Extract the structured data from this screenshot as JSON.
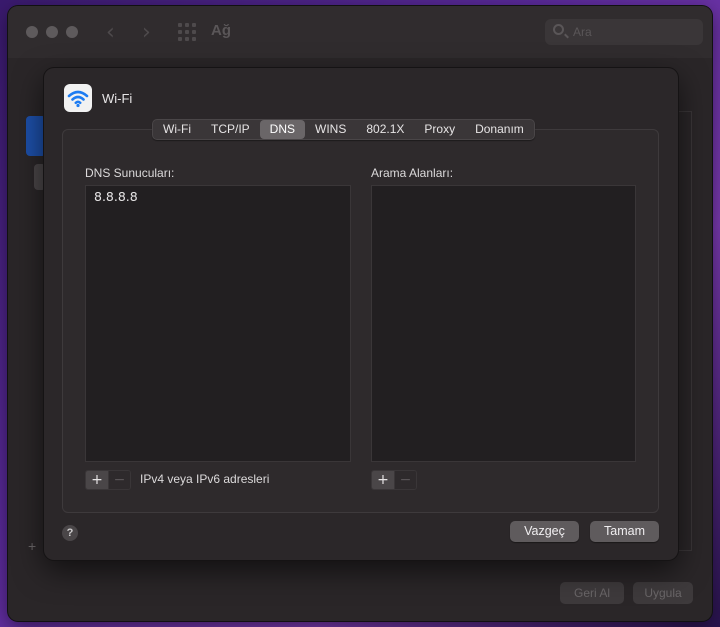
{
  "background_window": {
    "title": "Ağ",
    "search_placeholder": "Ara",
    "revert_label": "Geri Al",
    "apply_label": "Uygula"
  },
  "sheet": {
    "title": "Wi-Fi",
    "tabs": [
      {
        "label": "Wi-Fi",
        "active": false
      },
      {
        "label": "TCP/IP",
        "active": false
      },
      {
        "label": "DNS",
        "active": true
      },
      {
        "label": "WINS",
        "active": false
      },
      {
        "label": "802.1X",
        "active": false
      },
      {
        "label": "Proxy",
        "active": false
      },
      {
        "label": "Donanım",
        "active": false
      }
    ],
    "dns_servers": {
      "label": "DNS Sunucuları:",
      "entries": [
        "8.8.8.8"
      ],
      "hint": "IPv4 veya IPv6 adresleri"
    },
    "search_domains": {
      "label": "Arama Alanları:",
      "entries": []
    },
    "help_label": "?",
    "cancel_label": "Vazgeç",
    "ok_label": "Tamam"
  },
  "colors": {
    "accent_blue": "#1d7cf2",
    "active_tab": "#6a6668",
    "button_bg": "#5f5b5d"
  }
}
